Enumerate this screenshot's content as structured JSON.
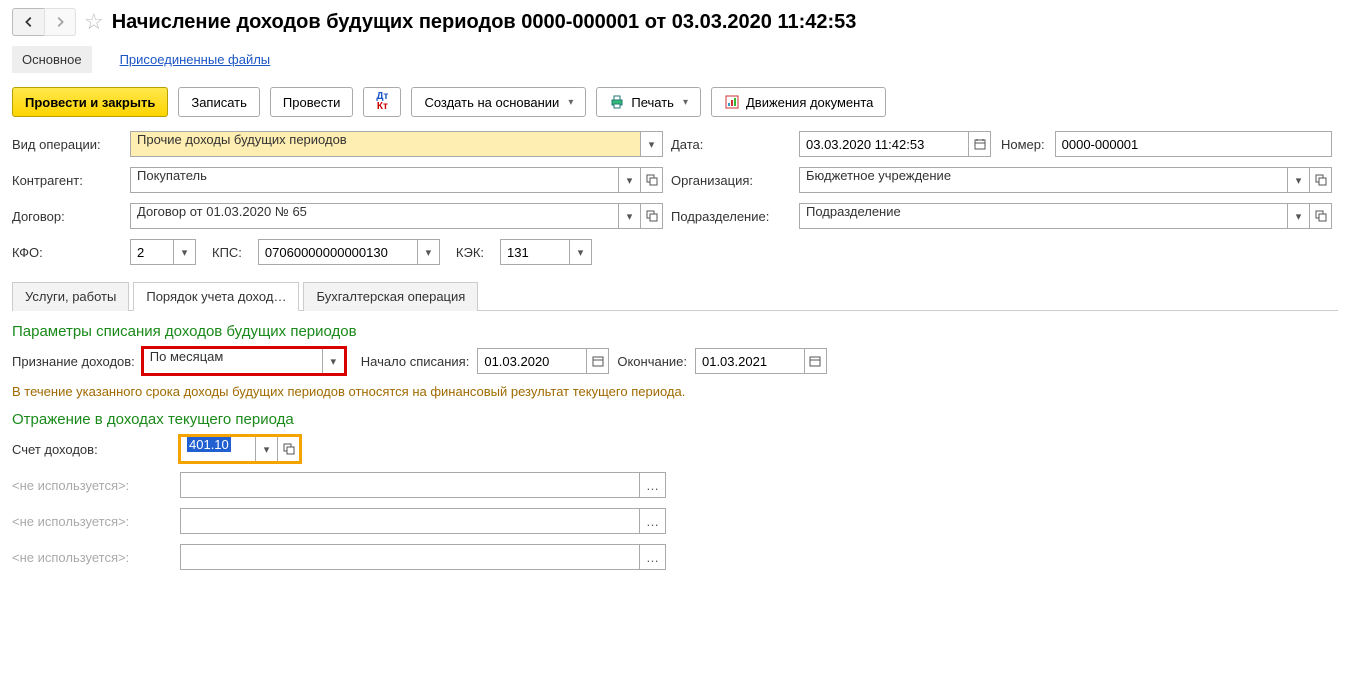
{
  "header": {
    "title": "Начисление доходов будущих периодов 0000-000001 от 03.03.2020 11:42:53"
  },
  "navTabs": {
    "main": "Основное",
    "files": "Присоединенные файлы"
  },
  "toolbar": {
    "postClose": "Провести и закрыть",
    "write": "Записать",
    "post": "Провести",
    "createFrom": "Создать на основании",
    "print": "Печать",
    "movements": "Движения документа"
  },
  "form": {
    "opTypeLabel": "Вид операции:",
    "opType": "Прочие доходы будущих периодов",
    "dateLabel": "Дата:",
    "date": "03.03.2020 11:42:53",
    "numberLabel": "Номер:",
    "number": "0000-000001",
    "counterpartyLabel": "Контрагент:",
    "counterparty": "Покупатель",
    "orgLabel": "Организация:",
    "org": "Бюджетное учреждение",
    "contractLabel": "Договор:",
    "contract": "Договор от 01.03.2020 № 65",
    "deptLabel": "Подразделение:",
    "dept": "Подразделение",
    "kfoLabel": "КФО:",
    "kfo": "2",
    "kpsLabel": "КПС:",
    "kps": "07060000000000130",
    "kekLabel": "КЭК:",
    "kek": "131"
  },
  "tabs2": {
    "services": "Услуги, работы",
    "order": "Порядок учета доход…",
    "operation": "Бухгалтерская операция"
  },
  "section1": {
    "title": "Параметры списания доходов будущих периодов",
    "recognitionLabel": "Признание доходов:",
    "recognition": "По месяцам",
    "startLabel": "Начало списания:",
    "start": "01.03.2020",
    "endLabel": "Окончание:",
    "end": "01.03.2021",
    "hint": "В течение указанного срока доходы будущих периодов относятся на финансовый результат текущего периода."
  },
  "section2": {
    "title": "Отражение в доходах текущего периода",
    "accountLabel": "Счет доходов:",
    "account": "401.10",
    "notUsed": "<не используется>:"
  }
}
